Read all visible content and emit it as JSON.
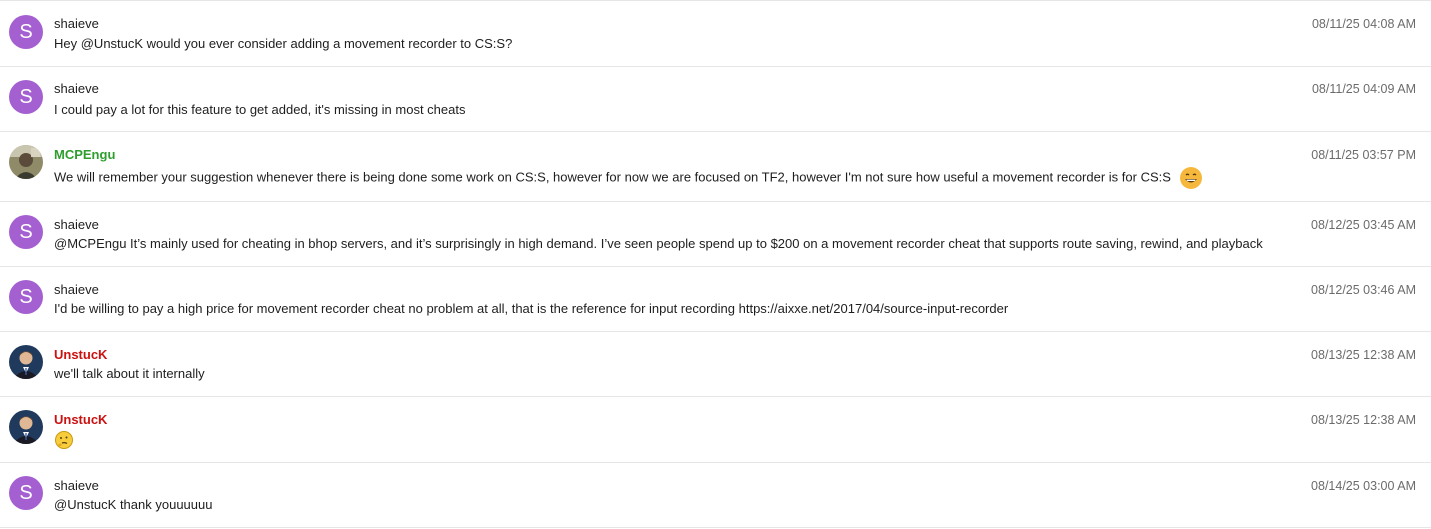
{
  "messages": [
    {
      "author": "shaieve",
      "avatar_letter": "S",
      "time": "08/11/25 04:08 AM",
      "text": "Hey @UnstucK would you ever consider adding a movement recorder to CS:S?"
    },
    {
      "author": "shaieve",
      "avatar_letter": "S",
      "time": "08/11/25 04:09 AM",
      "text": "I could pay a lot for this feature to get added, it's missing in most cheats"
    },
    {
      "author": "MCPEngu",
      "time": "08/11/25 03:57 PM",
      "text": "We will remember your suggestion whenever there is being done some work on CS:S, however for now we are focused on TF2, however I'm not sure how useful a movement recorder is for CS:S",
      "emoji": "grinning-sweat-emoji"
    },
    {
      "author": "shaieve",
      "avatar_letter": "S",
      "time": "08/12/25 03:45 AM",
      "text": "@MCPEngu It’s mainly used for cheating in bhop servers, and it’s surprisingly in high demand. I’ve seen people spend up to $200 on a movement recorder cheat that supports route saving, rewind, and playback"
    },
    {
      "author": "shaieve",
      "avatar_letter": "S",
      "time": "08/12/25 03:46 AM",
      "text": "I'd be willing to pay a high price for movement recorder cheat no problem at all, that is the reference for input recording https://aixxe.net/2017/04/source-input-recorder"
    },
    {
      "author": "UnstucK",
      "time": "08/13/25 12:38 AM",
      "text": "we'll talk about it internally"
    },
    {
      "author": "UnstucK",
      "time": "08/13/25 12:38 AM",
      "text": "",
      "emoji": "thinking-face-emoji"
    },
    {
      "author": "shaieve",
      "avatar_letter": "S",
      "time": "08/14/25 03:00 AM",
      "text": "@UnstucK thank youuuuuu"
    }
  ],
  "colors": {
    "avatar_purple": "#a45fd0",
    "mod_green": "#2f9e2f",
    "admin_red": "#cc1111",
    "divider": "#e6e6e6",
    "timestamp": "#6b6b6b"
  }
}
